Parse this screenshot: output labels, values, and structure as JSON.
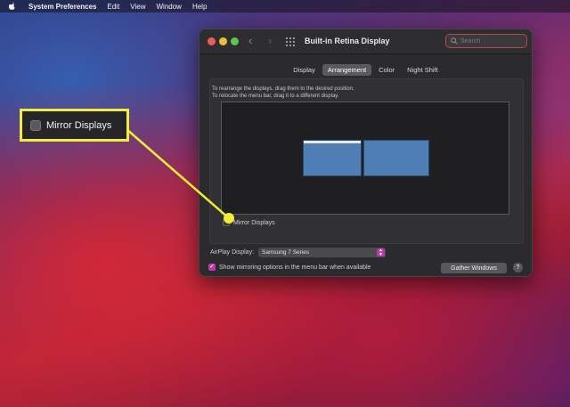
{
  "menubar": {
    "app": "System Preferences",
    "items": [
      "Edit",
      "View",
      "Window",
      "Help"
    ]
  },
  "window": {
    "title": "Built-in Retina Display",
    "search_placeholder": "Search",
    "tabs": [
      {
        "label": "Display",
        "active": false
      },
      {
        "label": "Arrangement",
        "active": true
      },
      {
        "label": "Color",
        "active": false
      },
      {
        "label": "Night Shift",
        "active": false
      }
    ],
    "instructions_line1": "To rearrange the displays, drag them to the desired position.",
    "instructions_line2": "To relocate the menu bar, drag it to a different display.",
    "mirror_label": "Mirror Displays",
    "airplay_label": "AirPlay Display:",
    "airplay_value": "Samsung 7 Series",
    "show_mirroring_label": "Show mirroring options in the menu bar when available",
    "show_mirroring_checked": true,
    "gather_button": "Gather Windows",
    "help_button": "?"
  },
  "callout": {
    "label": "Mirror Displays"
  },
  "colors": {
    "accent": "#b93aa8",
    "callout_border": "#f1ee3a",
    "display_blue": "#4e7eb4",
    "window_bg": "#2b2b2d"
  },
  "icons": [
    "apple-icon",
    "back-icon",
    "forward-icon",
    "grid-icon",
    "search-icon",
    "checkbox-icon",
    "popup-arrows-icon",
    "checkmark-icon",
    "help-icon"
  ]
}
